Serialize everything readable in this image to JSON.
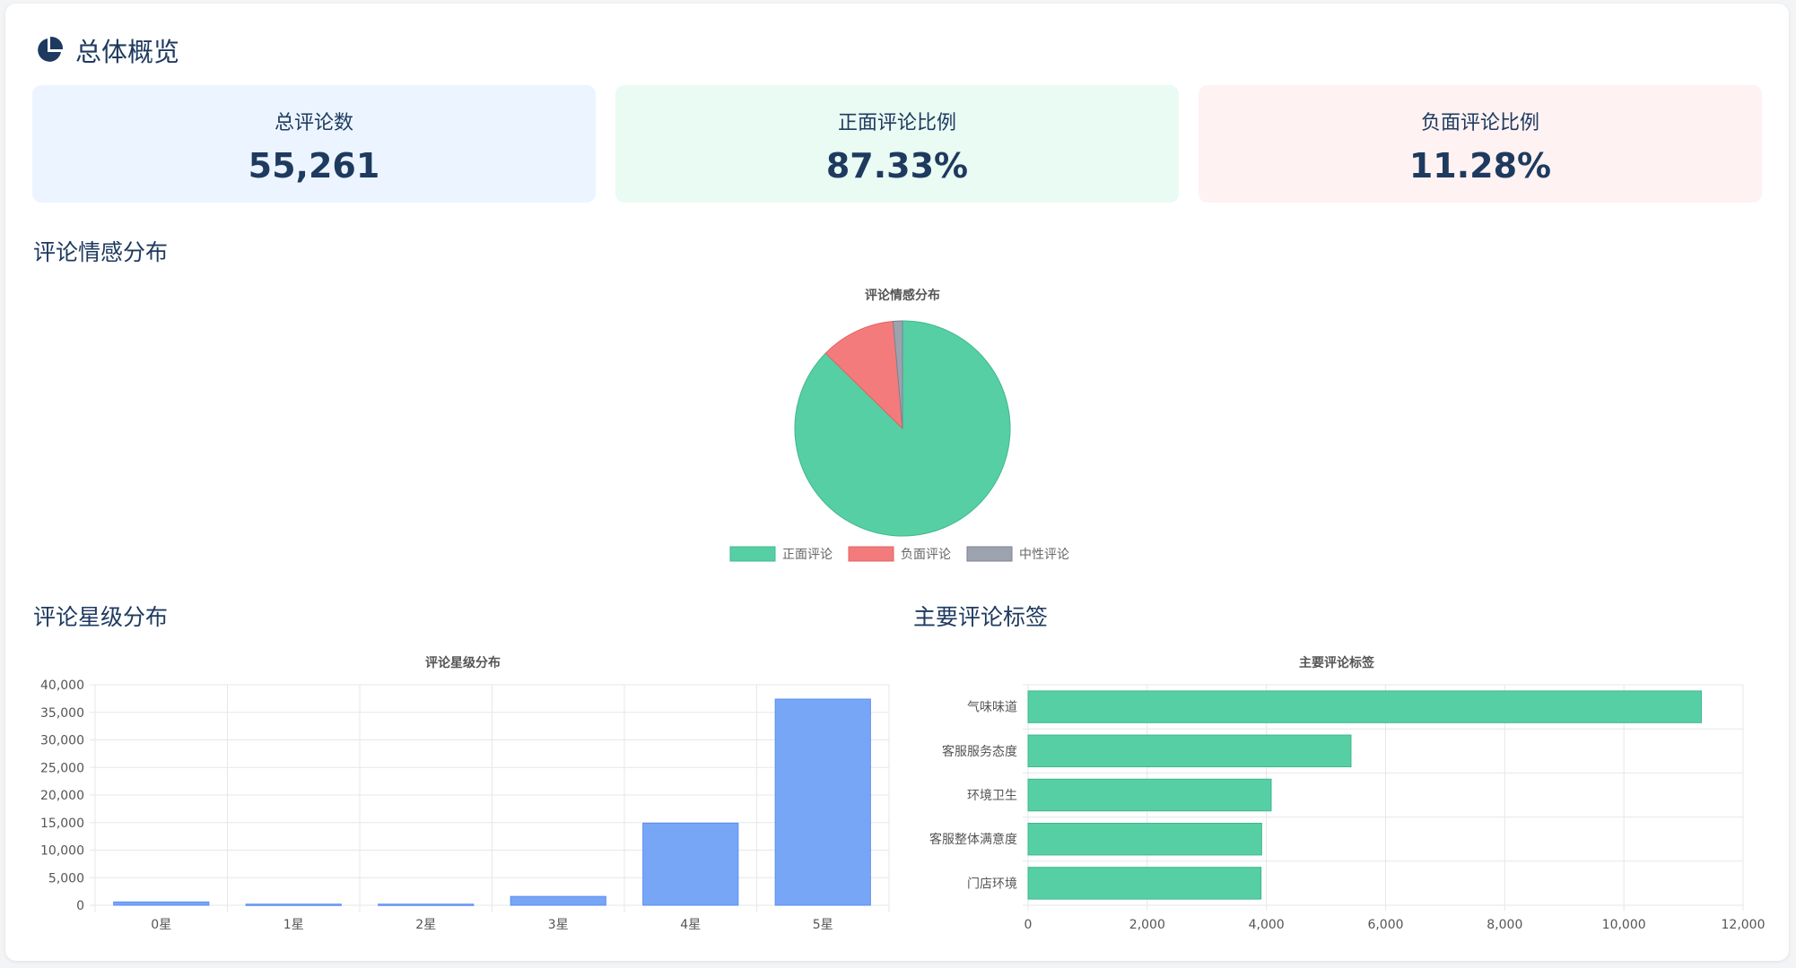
{
  "header": {
    "title": "总体概览",
    "icon": "pie-chart-icon"
  },
  "stats": [
    {
      "label": "总评论数",
      "value": "55,261",
      "bg": "#ecf5ff"
    },
    {
      "label": "正面评论比例",
      "value": "87.33%",
      "bg": "#e9fbf3"
    },
    {
      "label": "负面评论比例",
      "value": "11.28%",
      "bg": "#fef2f2"
    }
  ],
  "sections": {
    "sentiment": "评论情感分布",
    "stars": "评论星级分布",
    "tags": "主要评论标签"
  },
  "colors": {
    "positive": "#57cfa5",
    "negative": "#f47b7b",
    "neutral": "#9ca3af",
    "blue": "#78a6f7",
    "grid": "#e5e7eb",
    "text": "#1e3a5f",
    "axis": "#555555"
  },
  "chart_data": [
    {
      "type": "pie",
      "title": "评论情感分布",
      "categories": [
        "正面评论",
        "负面评论",
        "中性评论"
      ],
      "values": [
        87.33,
        11.28,
        1.39
      ],
      "legend": "bottom"
    },
    {
      "type": "bar",
      "title": "评论星级分布",
      "categories": [
        "0星",
        "1星",
        "2星",
        "3星",
        "4星",
        "5星"
      ],
      "values": [
        600,
        200,
        200,
        1600,
        14900,
        37400
      ],
      "ylim": [
        0,
        40000
      ],
      "yticks": [
        "0",
        "5,000",
        "10,000",
        "15,000",
        "20,000",
        "25,000",
        "30,000",
        "35,000",
        "40,000"
      ],
      "grid": true
    },
    {
      "type": "bar",
      "orientation": "horizontal",
      "title": "主要评论标签",
      "categories": [
        "气味味道",
        "客服服务态度",
        "环境卫生",
        "客服整体满意度",
        "门店环境"
      ],
      "values": [
        11300,
        5420,
        4080,
        3920,
        3910
      ],
      "xlim": [
        0,
        12000
      ],
      "xticks": [
        "0",
        "2,000",
        "4,000",
        "6,000",
        "8,000",
        "10,000",
        "12,000"
      ],
      "grid": true
    }
  ]
}
